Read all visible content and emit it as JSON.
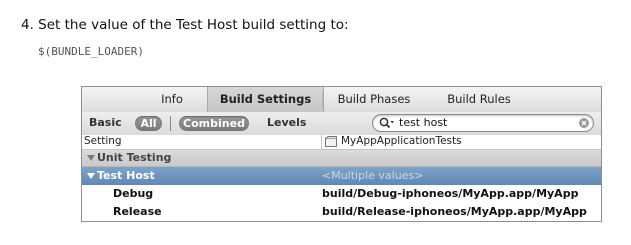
{
  "instruction": {
    "step_text": "4. Set the value of the Test Host build setting to:",
    "code_value": "$(BUNDLE_LOADER)"
  },
  "tabs": [
    {
      "label": "Info",
      "active": false
    },
    {
      "label": "Build Settings",
      "active": true
    },
    {
      "label": "Build Phases",
      "active": false
    },
    {
      "label": "Build Rules",
      "active": false
    }
  ],
  "toolbar": {
    "basic_label": "Basic",
    "all_label": "All",
    "combined_label": "Combined",
    "levels_label": "Levels",
    "search_value": "test host"
  },
  "columns": {
    "setting_header": "Setting",
    "target_name": "MyAppApplicationTests"
  },
  "group": {
    "name": "Unit Testing"
  },
  "selected_setting": {
    "name": "Test Host",
    "value": "<Multiple values>"
  },
  "rows": [
    {
      "name": "Debug",
      "value": "build/Debug-iphoneos/MyApp.app/MyApp"
    },
    {
      "name": "Release",
      "value": "build/Release-iphoneos/MyApp.app/MyApp"
    }
  ],
  "colors": {
    "selection": "#6b91ba",
    "pill": "#858585",
    "group_header": "#d3d3d3"
  }
}
